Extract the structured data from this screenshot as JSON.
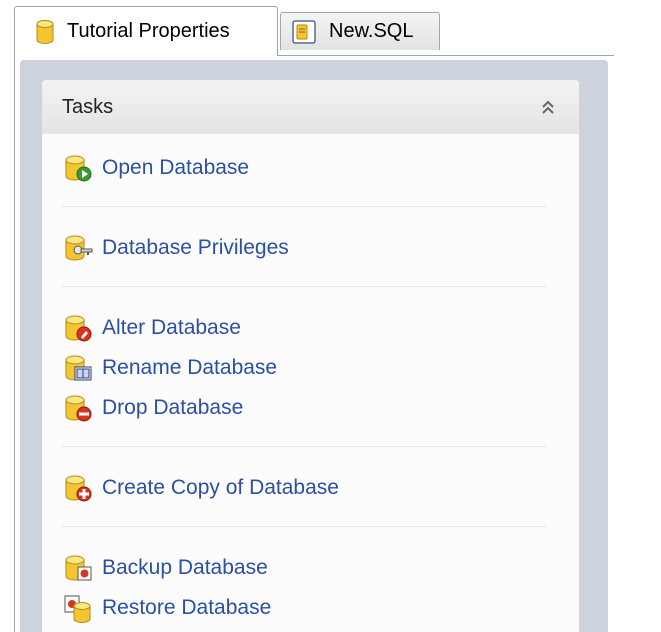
{
  "tabs": [
    {
      "label": "Tutorial Properties",
      "icon": "database-icon",
      "active": true
    },
    {
      "label": "New.SQL",
      "icon": "sql-file-icon",
      "active": false
    }
  ],
  "tasks_panel": {
    "title": "Tasks",
    "collapse_icon": "double-chevron-up-icon",
    "groups": [
      [
        {
          "label": "Open Database",
          "icon": "open-database-icon"
        }
      ],
      [
        {
          "label": "Database Privileges",
          "icon": "database-key-icon"
        }
      ],
      [
        {
          "label": "Alter Database",
          "icon": "alter-database-icon"
        },
        {
          "label": "Rename Database",
          "icon": "rename-database-icon"
        },
        {
          "label": "Drop Database",
          "icon": "drop-database-icon"
        }
      ],
      [
        {
          "label": "Create Copy of Database",
          "icon": "copy-database-icon"
        }
      ],
      [
        {
          "label": "Backup Database",
          "icon": "backup-database-icon"
        },
        {
          "label": "Restore Database",
          "icon": "restore-database-icon"
        }
      ]
    ]
  },
  "colors": {
    "link": "#2a4fa3",
    "panel_bg": "#cdd3dd",
    "db_yellow": "#f2c531"
  }
}
